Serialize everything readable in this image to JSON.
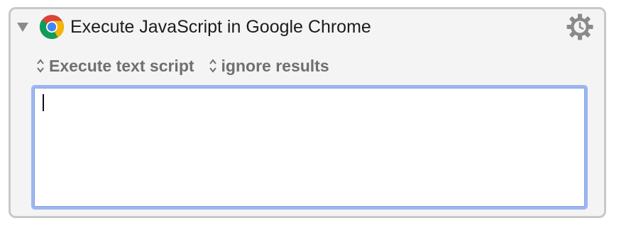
{
  "action": {
    "title": "Execute JavaScript in Google Chrome",
    "app_icon": "chrome-icon",
    "gear_icon": "gear-icon",
    "disclosure_icon": "disclosure-triangle-icon",
    "options": [
      {
        "label": "Execute text script",
        "icon": "updown-chevron-icon"
      },
      {
        "label": "ignore results",
        "icon": "updown-chevron-icon"
      }
    ],
    "script": {
      "value": "",
      "placeholder": ""
    }
  },
  "colors": {
    "panel_background": "#f4f4f4",
    "panel_border": "#c8c8c8",
    "focus_ring": "#9db6f0",
    "option_text": "#6f6f6f",
    "gear": "#8a8a8a"
  }
}
